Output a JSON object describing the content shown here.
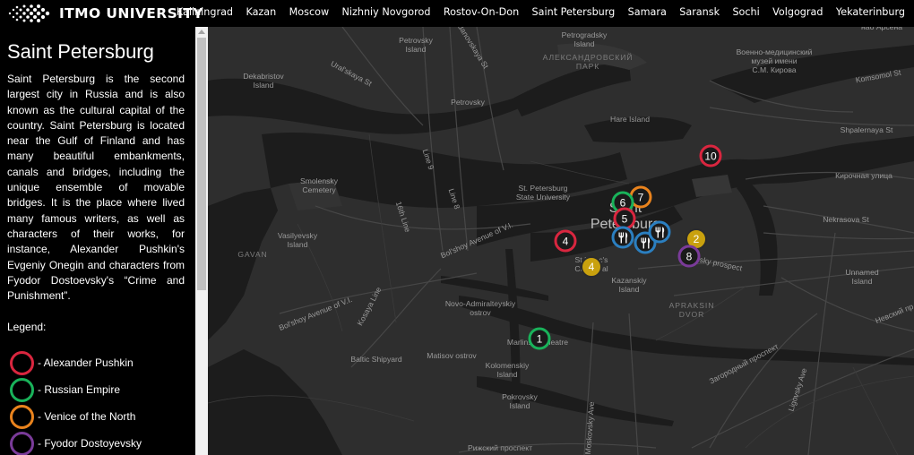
{
  "header": {
    "logo_text": "ITMO UNIVERSITY",
    "cities": [
      "Kaliningrad",
      "Kazan",
      "Moscow",
      "Nizhniy Novgorod",
      "Rostov-On-Don",
      "Saint Petersburg",
      "Samara",
      "Saransk",
      "Sochi",
      "Volgograd",
      "Yekaterinburg"
    ]
  },
  "sidebar": {
    "title": "Saint Petersburg",
    "description": "Saint Petersburg is the second largest city in Russia and is also known as the cultural capital of the country. Saint Petersburg is located near the Gulf of Finland and has many beautiful embankments, canals and bridges, including the unique ensemble of movable bridges. It is the place where lived many famous writers, as well as characters of their works, for instance, Alexander Pushkin's Evgeniy Onegin and characters from Fyodor Dostoevsky's “Crime and Punishment”.",
    "legend_title": "Legend:",
    "legend": [
      {
        "label": "- Alexander Pushkin",
        "color": "#d9263f"
      },
      {
        "label": "- Russian Empire",
        "color": "#19b25a"
      },
      {
        "label": "- Venice of the North",
        "color": "#e9831d"
      },
      {
        "label": "- Fyodor Dostoyevsky",
        "color": "#7a3b99"
      }
    ]
  },
  "map": {
    "colors": {
      "water": "#1c1c1c",
      "land": "#2e2e2e",
      "park": "#333333",
      "road": "#474747"
    },
    "labels": {
      "petrovsky": "Petrovsky\nIsland",
      "petrogradsky": "Petrogradsky\nIsland",
      "aleksandrovsky": "АЛЕКСАНДРОВСКИЙ\nПАРК",
      "voenno": "Военно-медицинский\nмузей имени\nС.М. Кирова",
      "dekabristov": "Dekabristov\nIsland",
      "uralskaya": "Ural'skaya St",
      "yalanovskaya": "Jdanovskaya St",
      "petrovsky_st": "Petrovsky",
      "hare": "Hare Island",
      "shpalernaya": "Shpalernaya St",
      "kirochnaya": "Кирочная улица",
      "smolensky": "Smolensky\nCemetery",
      "line9": "Line 9",
      "line8": "Line 8",
      "state_univ": "St. Petersburg\nState University",
      "nekrasova": "Nekrasova St",
      "vasilyevsky": "Vasilyevsky\nIsland",
      "line16": "16th Line",
      "bolshoy_vi": "Bol'shoy Avenue of V.I.",
      "city": "Saint\nPetersburg",
      "gavan": "GAVAN",
      "stisaac": "St Isaac's\nCathedral",
      "kazansky": "Kazanskiy\nIsland",
      "unnamed": "Unnamed\nIsland",
      "nevsky": "Nevsky prospect",
      "novo": "Novo-Admiralteyskiy\nostrov",
      "apraksin": "APRAKSIN\nDVOR",
      "bolshoy_vo": "Bol'shoy Avenue of V.I.",
      "kosaya": "Kosaya Line",
      "marlin": "Marlinsky Theatre",
      "baltic": "Baltic Shipyard",
      "matisov": "Matisov ostrov",
      "kolomensky": "Kolomenskiy\nIsland",
      "zagorodny": "Загородный проспект",
      "ligovsky": "Ligovsky Ave",
      "pokrovsky": "Pokrovsky\nIsland",
      "moskovsky": "Moskovsky Ave",
      "rizhsky": "Рижский проспект",
      "komsomol": "Komsomol St",
      "nevskiy_pr": "Невский пр",
      "nab": "наб Арсена"
    },
    "markers": [
      {
        "id": "m10",
        "text": "10",
        "style": "ring",
        "color": "#d9263f"
      },
      {
        "id": "m7",
        "text": "7",
        "style": "ring",
        "color": "#e9831d"
      },
      {
        "id": "m6",
        "text": "6",
        "style": "ring",
        "color": "#19b25a"
      },
      {
        "id": "m5",
        "text": "5",
        "style": "ring",
        "color": "#d9263f"
      },
      {
        "id": "m4",
        "text": "4",
        "style": "ring",
        "color": "#d9263f"
      },
      {
        "id": "m2",
        "text": "2",
        "style": "solid",
        "color": "#c9a10e"
      },
      {
        "id": "m4y",
        "text": "4",
        "style": "solid",
        "color": "#c9a10e"
      },
      {
        "id": "m8",
        "text": "8",
        "style": "ring",
        "color": "#7a3b99"
      },
      {
        "id": "m1",
        "text": "1",
        "style": "ring",
        "color": "#19b25a"
      },
      {
        "id": "f1",
        "icon": "fork-knife-icon",
        "style": "food",
        "color": "#2b7fc0"
      },
      {
        "id": "f2",
        "icon": "fork-knife-icon",
        "style": "food",
        "color": "#2b7fc0"
      },
      {
        "id": "f3",
        "icon": "fork-knife-icon",
        "style": "food",
        "color": "#2b7fc0"
      }
    ]
  }
}
